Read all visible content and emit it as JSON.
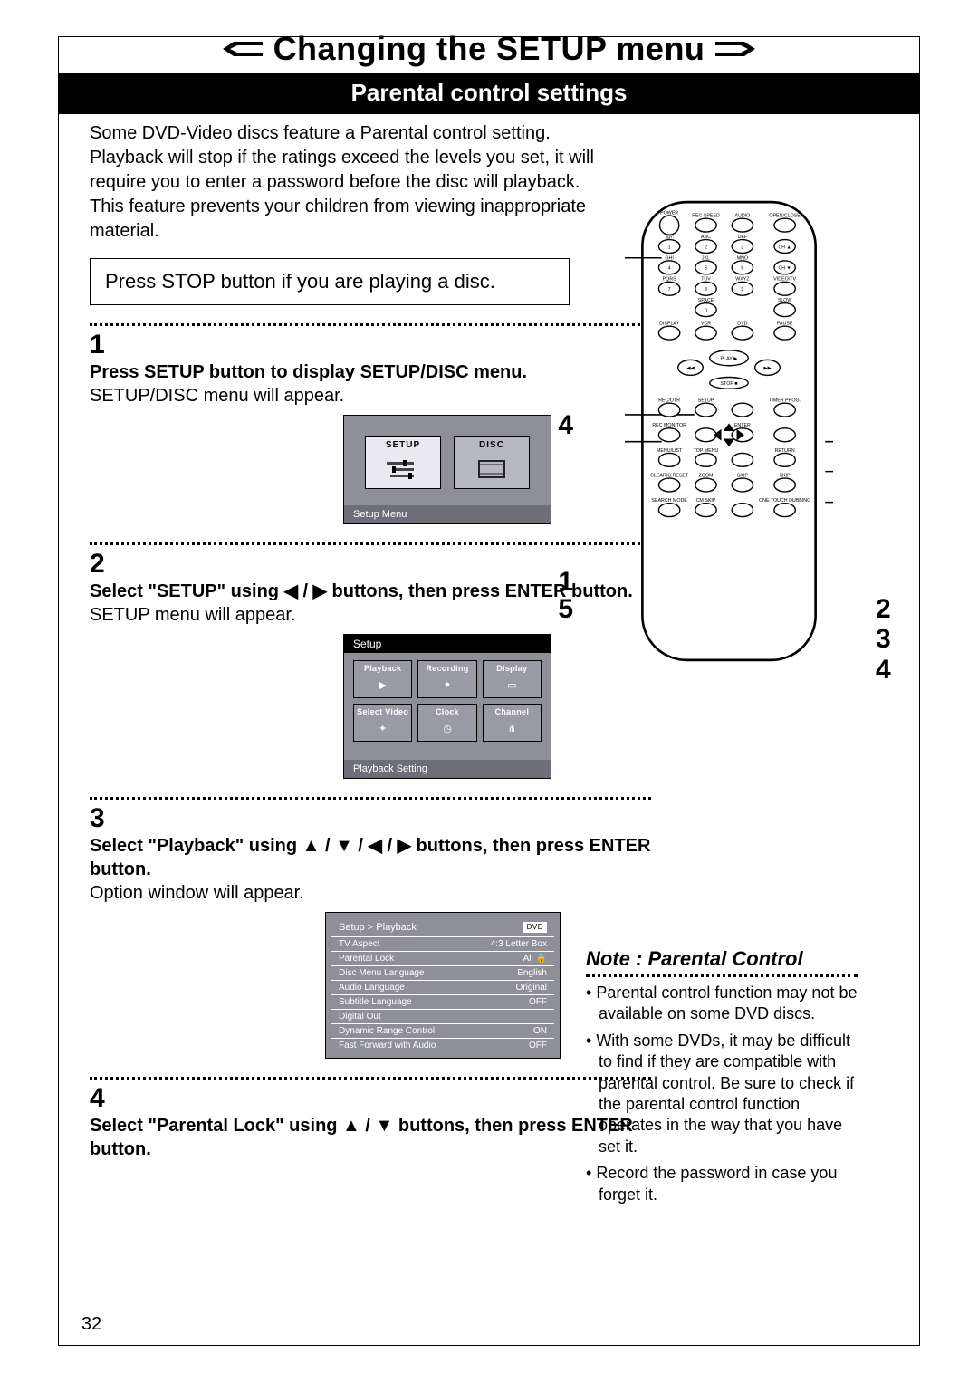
{
  "title": "Changing the SETUP menu",
  "subtitle": "Parental control settings",
  "intro": "Some DVD-Video discs feature a Parental control setting.\nPlayback will stop if the ratings exceed the levels you set, it will require you to enter a password before the disc will playback.\nThis feature prevents your children from viewing inappropriate material.",
  "stopbox": "Press STOP button if you are playing a disc.",
  "steps": [
    {
      "num": "1",
      "bold": "Press SETUP button to display SETUP/DISC menu.",
      "norm": "SETUP/DISC menu will appear."
    },
    {
      "num": "2",
      "bold": "Select \"SETUP\" using ◀ / ▶ buttons, then press ENTER button.",
      "norm": "SETUP menu will appear."
    },
    {
      "num": "3",
      "bold": "Select \"Playback\" using ▲ / ▼ / ◀ / ▶ buttons, then press ENTER button.",
      "norm": "Option window will appear."
    },
    {
      "num": "4",
      "bold": "Select \"Parental Lock\" using ▲ / ▼ buttons, then press ENTER button.",
      "norm": ""
    }
  ],
  "screen1": {
    "tab_setup": "SETUP",
    "tab_disc": "DISC",
    "footer": "Setup Menu"
  },
  "screen2": {
    "head": "Setup",
    "cells": [
      {
        "l": "Playback"
      },
      {
        "l": "Recording"
      },
      {
        "l": "Display"
      },
      {
        "l": "Select Video"
      },
      {
        "l": "Clock"
      },
      {
        "l": "Channel"
      }
    ],
    "footer": "Playback Setting"
  },
  "screen3": {
    "breadcrumb": "Setup > Playback",
    "tag": "DVD",
    "rows": [
      {
        "a": "TV Aspect",
        "b": "4:3 Letter Box"
      },
      {
        "a": "Parental Lock",
        "b": "All"
      },
      {
        "a": "Disc Menu Language",
        "b": "English"
      },
      {
        "a": "Audio Language",
        "b": "Original"
      },
      {
        "a": "Subtitle Language",
        "b": "OFF"
      },
      {
        "a": "Digital Out",
        "b": ""
      },
      {
        "a": "Dynamic Range Control",
        "b": "ON"
      },
      {
        "a": "Fast Forward with Audio",
        "b": "OFF"
      }
    ]
  },
  "remote_callouts": {
    "l4": "4",
    "l1": "1",
    "l5": "5",
    "r2": "2",
    "r3": "3",
    "r4": "4"
  },
  "remote_labels": {
    "row0": [
      "POWER",
      "REC SPEED",
      "AUDIO",
      "OPEN/CLOSE"
    ],
    "row1": [
      ".@/:",
      "ABC",
      "DEF",
      ""
    ],
    "row1d": [
      "1",
      "2",
      "3",
      "CH ▲"
    ],
    "row2": [
      "GHI",
      "JKL",
      "MNO",
      ""
    ],
    "row2d": [
      "4",
      "5",
      "6",
      "CH ▼"
    ],
    "row3": [
      "PQRS",
      "TUV",
      "WXYZ",
      "VIDEO/TV"
    ],
    "row3d": [
      "7",
      "8",
      "9",
      ""
    ],
    "row4": [
      "SPACE",
      "",
      "SLOW"
    ],
    "row4d": [
      "0"
    ],
    "row5": [
      "DISPLAY",
      "VCR",
      "DVD",
      "PAUSE"
    ],
    "nav": [
      "◀◀",
      "PLAY ▶",
      "▶▶",
      "STOP ■"
    ],
    "row6": [
      "REC/OTR",
      "SETUP",
      "",
      "TIMER PROG."
    ],
    "row7": [
      "REC MONITOR",
      "",
      "ENTER",
      ""
    ],
    "row8": [
      "MENU/LIST",
      "TOP MENU",
      "",
      "RETURN"
    ],
    "row9": [
      "CLEAR/C.RESET",
      "ZOOM",
      "SKIP",
      "SKIP"
    ],
    "row10": [
      "SEARCH MODE",
      "CM SKIP",
      "",
      "ONE TOUCH DUBBING"
    ]
  },
  "note": {
    "title": "Note : Parental Control",
    "items": [
      "Parental control function may not be available on some DVD discs.",
      "With some DVDs, it may be difficult to find if they are compatible with parental control. Be sure to check if the parental control function operates in the way that you have set it.",
      "Record the password in case you forget it."
    ]
  },
  "page": "32"
}
